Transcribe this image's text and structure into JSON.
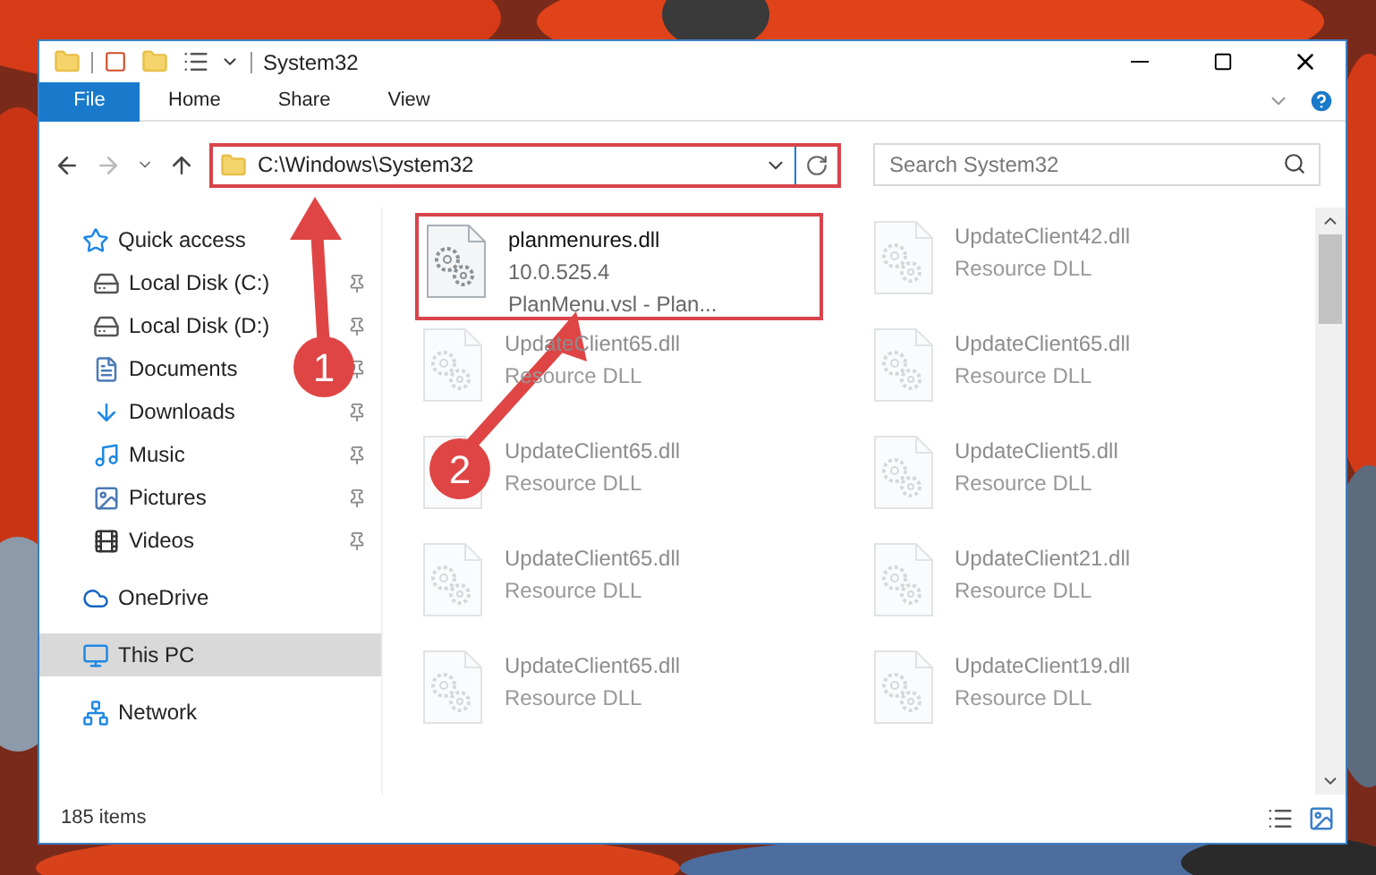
{
  "window": {
    "title": "System32"
  },
  "ribbon": {
    "tabs": [
      {
        "label": "File",
        "selected": true
      },
      {
        "label": "Home",
        "selected": false
      },
      {
        "label": "Share",
        "selected": false
      },
      {
        "label": "View",
        "selected": false
      }
    ]
  },
  "address": {
    "path": "C:\\Windows\\System32",
    "highlighted": true
  },
  "search": {
    "placeholder": "Search System32"
  },
  "sidebar": {
    "items": [
      {
        "label": "Quick access",
        "kind": "star",
        "pinned": false,
        "selected": false,
        "children": [
          {
            "label": "Local Disk (C:)",
            "kind": "system-disk",
            "pinned": true,
            "selected": false
          },
          {
            "label": "Local Disk (D:)",
            "kind": "disk",
            "pinned": true,
            "selected": false
          },
          {
            "label": "Documents",
            "kind": "documents",
            "pinned": true,
            "selected": false
          },
          {
            "label": "Downloads",
            "kind": "downloads",
            "pinned": true,
            "selected": false
          },
          {
            "label": "Music",
            "kind": "music",
            "pinned": true,
            "selected": false
          },
          {
            "label": "Pictures",
            "kind": "pictures",
            "pinned": true,
            "selected": false
          },
          {
            "label": "Videos",
            "kind": "videos",
            "pinned": true,
            "selected": false
          }
        ]
      },
      {
        "label": "OneDrive",
        "kind": "cloud",
        "pinned": false,
        "selected": false
      },
      {
        "label": "This PC",
        "kind": "pc",
        "pinned": false,
        "selected": true
      },
      {
        "label": "Network",
        "kind": "network",
        "pinned": false,
        "selected": false
      }
    ]
  },
  "files": [
    {
      "name": "planmenures.dll",
      "lines": [
        "10.0.525.4",
        "PlanMenu.vsl - Plan..."
      ],
      "highlighted": true,
      "faded": false
    },
    {
      "name": "UpdateClient42.dll",
      "lines": [
        "Resource DLL"
      ],
      "highlighted": false,
      "faded": true
    },
    {
      "name": "UpdateClient65.dll",
      "lines": [
        "Resource DLL"
      ],
      "highlighted": false,
      "faded": true
    },
    {
      "name": "UpdateClient65.dll",
      "lines": [
        "Resource DLL"
      ],
      "highlighted": false,
      "faded": true
    },
    {
      "name": "UpdateClient65.dll",
      "lines": [
        "Resource DLL"
      ],
      "highlighted": false,
      "faded": true
    },
    {
      "name": "UpdateClient5.dll",
      "lines": [
        "Resource DLL"
      ],
      "highlighted": false,
      "faded": true
    },
    {
      "name": "UpdateClient65.dll",
      "lines": [
        "Resource DLL"
      ],
      "highlighted": false,
      "faded": true
    },
    {
      "name": "UpdateClient21.dll",
      "lines": [
        "Resource DLL"
      ],
      "highlighted": false,
      "faded": true
    },
    {
      "name": "UpdateClient65.dll",
      "lines": [
        "Resource DLL"
      ],
      "highlighted": false,
      "faded": true
    },
    {
      "name": "UpdateClient19.dll",
      "lines": [
        "Resource DLL"
      ],
      "highlighted": false,
      "faded": true
    }
  ],
  "status_bar": {
    "count": "185 items"
  },
  "callouts": [
    {
      "label": "1"
    },
    {
      "label": "2"
    }
  ]
}
